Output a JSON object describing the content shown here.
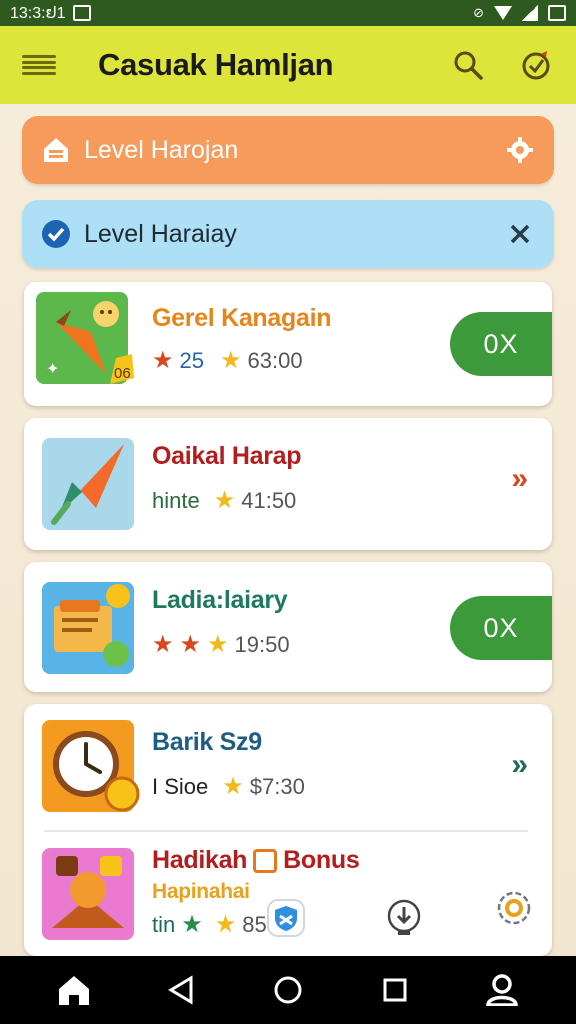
{
  "status_bar": {
    "time": "13:3:ຢ1"
  },
  "app_bar": {
    "title": "Casuak Hamljan",
    "icons": [
      "menu-icon",
      "search-icon",
      "trophy-icon"
    ]
  },
  "banners": [
    {
      "label": "Level Harojan",
      "icon": "house-icon",
      "end_icon": "gear-icon",
      "color": "#f79b5c"
    },
    {
      "label": "Level Haraiay",
      "icon": "check-circle-icon",
      "end_icon": "close-icon",
      "color": "#ade0f6"
    }
  ],
  "cards": [
    {
      "title": "Gerel Kanagain",
      "title_color": "#e8851a",
      "rating_a": "25",
      "rating_b": "63:00",
      "badge": "06",
      "action": "0X"
    },
    {
      "title": "Oaikal Harap",
      "title_color": "#b31d1d",
      "label": "hinte",
      "rating_b": "41:50",
      "action": "»"
    },
    {
      "title": "Ladia:laiary",
      "title_color": "#1d7a5d",
      "rating_b": "19:50",
      "action": "0X"
    },
    {
      "title": "Barik Sz9",
      "title_color": "#1d5d84",
      "label": "I Sioe",
      "rating_b": "$7:30",
      "action": "»"
    },
    {
      "title": "Hadikah",
      "bonus": "Bonus",
      "subtitle": "Hapinahai",
      "title_color": "#b31d1d",
      "subtitle_color": "#e8a21a",
      "label": "tin",
      "rating_b": "85"
    }
  ],
  "nav": [
    "home-icon",
    "back-icon",
    "circle-home-icon",
    "recents-icon",
    "profile-icon"
  ]
}
